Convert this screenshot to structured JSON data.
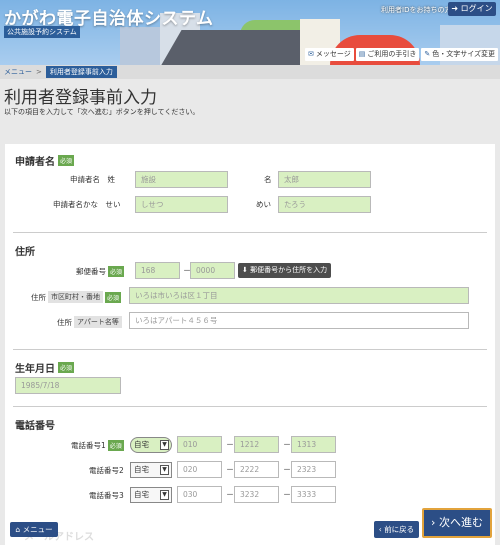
{
  "header": {
    "app_title": "かがわ電子自治体システム",
    "subtitle": "公共施設予約システム",
    "id_link": "利用者IDをお持ちの方",
    "login": "ログイン",
    "links": [
      {
        "label": "メッセージ",
        "icon": "message-icon"
      },
      {
        "label": "ご利用の手引き",
        "icon": "guide-icon"
      },
      {
        "label": "色・文字サイズ変更",
        "icon": "pencil-icon"
      }
    ]
  },
  "breadcrumb": {
    "home": "メニュー",
    "separator": ">",
    "current": "利用者登録事前入力"
  },
  "page": {
    "title": "利用者登録事前入力",
    "instruction": "以下の項目を入力して「次へ進む」ボタンを押してください。"
  },
  "required_label": "必須",
  "applicant": {
    "title": "申請者名",
    "name_label": "申請者名　姓",
    "last_name_placeholder": "施設",
    "first_label": "名",
    "first_name_placeholder": "太郎",
    "kana_label": "申請者名かな　せい",
    "last_kana_placeholder": "しせつ",
    "first_kana_label": "めい",
    "first_kana_placeholder": "たろう"
  },
  "address": {
    "title": "住所",
    "zip_label": "郵便番号",
    "zip1_placeholder": "168",
    "zip2_placeholder": "0000",
    "zip_dash": "－",
    "zip_button": "郵便番号から住所を入力",
    "addr_label": "住所",
    "addr_tag": "市区町村・番地",
    "addr_placeholder": "いろは市いろは区１丁目",
    "apt_label": "住所",
    "apt_tag": "アパート名等",
    "apt_placeholder": "いろはアパート４５６号"
  },
  "birthday": {
    "title": "生年月日",
    "placeholder": "1985/7/18"
  },
  "phone": {
    "title": "電話番号",
    "dash": "－",
    "rows": [
      {
        "label": "電話番号1",
        "type": "自宅",
        "p1": "010",
        "p2": "1212",
        "p3": "1313",
        "required": true
      },
      {
        "label": "電話番号2",
        "type": "自宅",
        "p1": "020",
        "p2": "2222",
        "p3": "2323",
        "required": false
      },
      {
        "label": "電話番号3",
        "type": "自宅",
        "p1": "030",
        "p2": "3232",
        "p3": "3333",
        "required": false
      }
    ]
  },
  "next_section_partial": "メールアドレス",
  "footer": {
    "menu": "メニュー",
    "back": "前に戻る",
    "next": "次へ進む"
  },
  "colors": {
    "primary": "#2c4e86",
    "input_green": "#d9f0c2",
    "required": "#6aa84f",
    "accent_border": "#e2a33c"
  }
}
